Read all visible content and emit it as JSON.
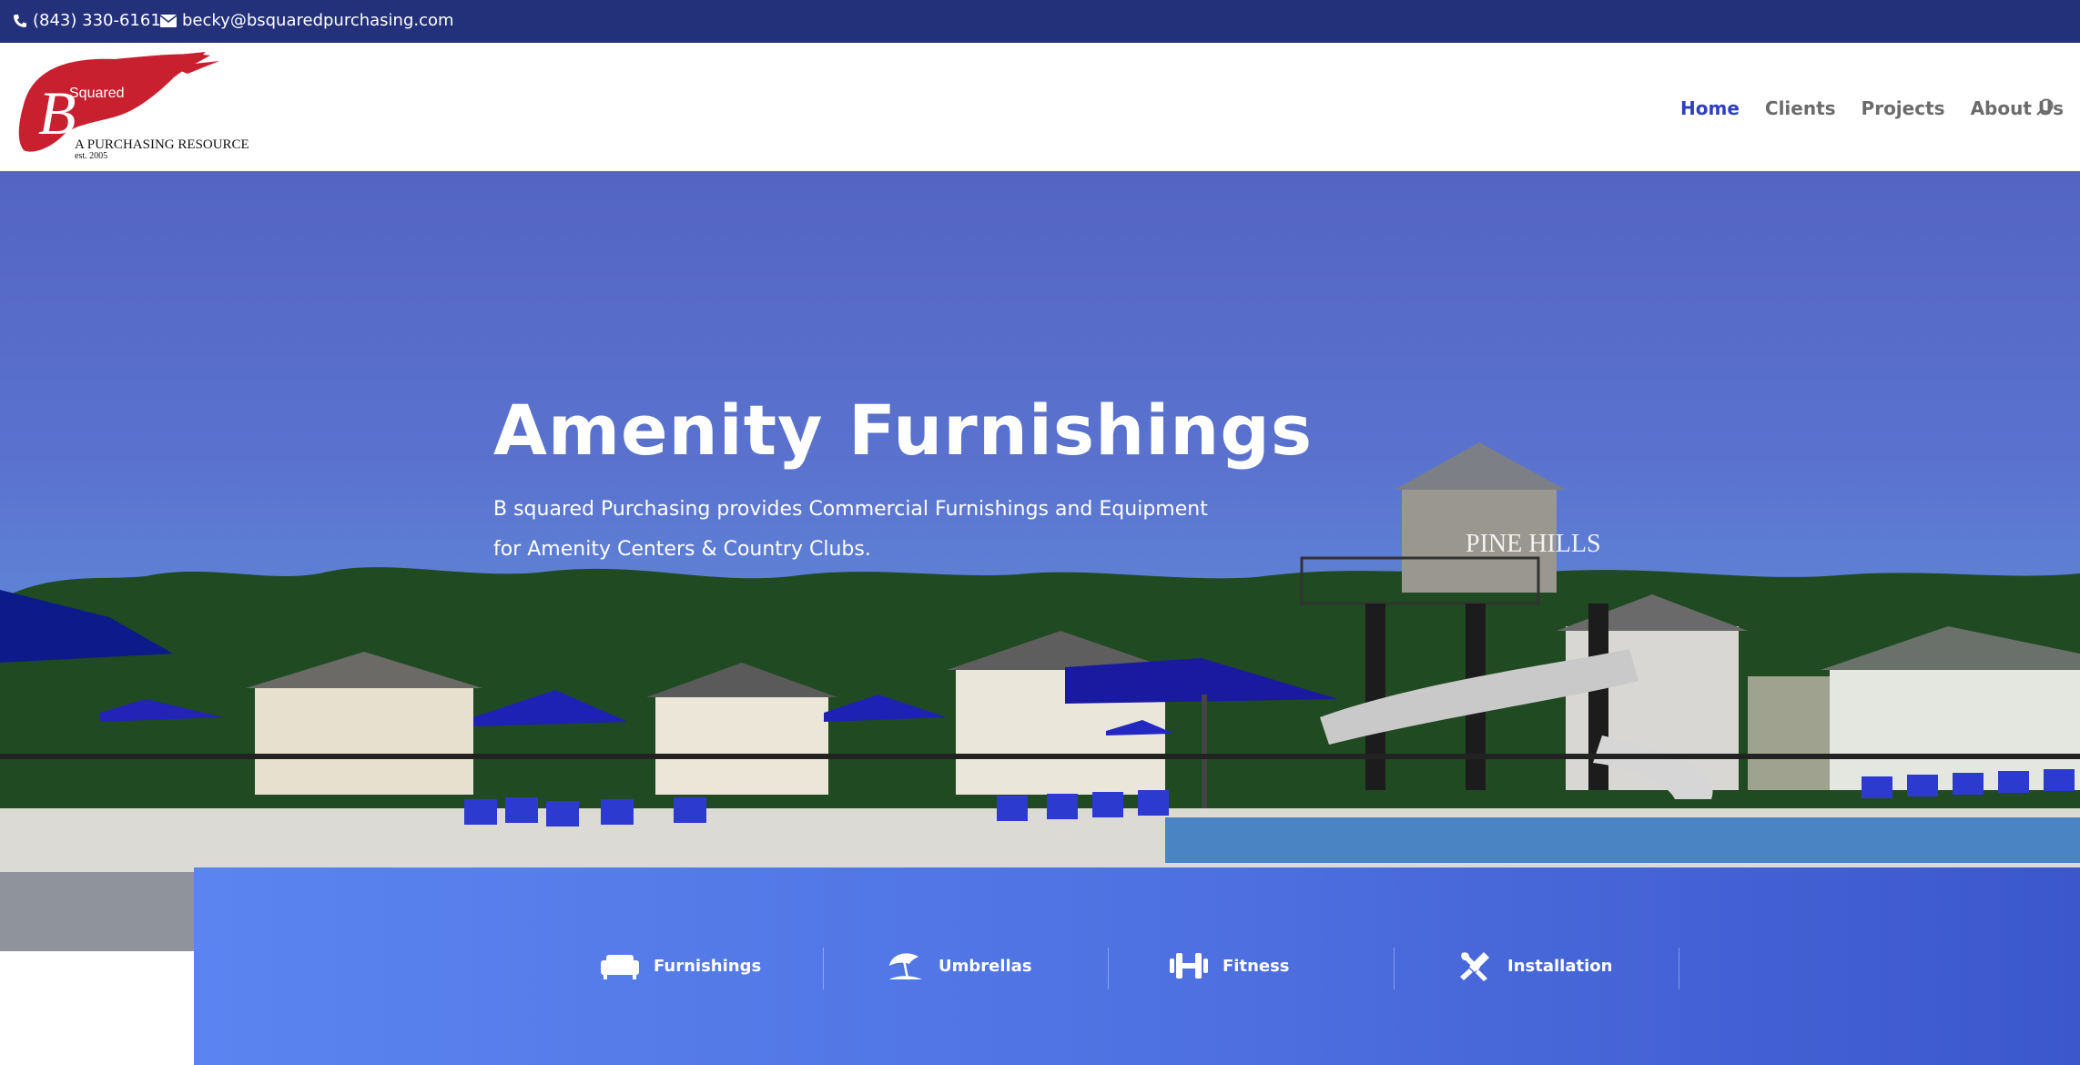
{
  "topbar": {
    "phone": "(843) 330-6161",
    "email": "becky@bsquaredpurchasing.com",
    "phone_icon": "phone-icon",
    "email_icon": "envelope-icon"
  },
  "logo": {
    "mark": "B",
    "word": "Squared",
    "tagline": "A PURCHASING RESOURCE",
    "established": "est. 2005",
    "brand_color": "#c8202f"
  },
  "nav": {
    "items": [
      {
        "label": "Home",
        "active": true
      },
      {
        "label": "Clients",
        "active": false
      },
      {
        "label": "Projects",
        "active": false
      },
      {
        "label": "About Us",
        "active": false
      }
    ],
    "search_icon": "search-icon"
  },
  "hero": {
    "title": "Amenity Furnishings",
    "subtitle": "B squared Purchasing provides Commercial Furnishings and Equipment for Amenity Centers & Country Clubs.",
    "sign_text": "PINE HILLS"
  },
  "services": [
    {
      "label": "Furnishings",
      "icon": "sofa-icon"
    },
    {
      "label": "Umbrellas",
      "icon": "umbrella-icon"
    },
    {
      "label": "Fitness",
      "icon": "dumbbell-icon"
    },
    {
      "label": "Installation",
      "icon": "tools-icon"
    }
  ],
  "colors": {
    "topbar": "#23307a",
    "nav_active": "#2e3ebf",
    "services_bar": "#4f72e2"
  }
}
